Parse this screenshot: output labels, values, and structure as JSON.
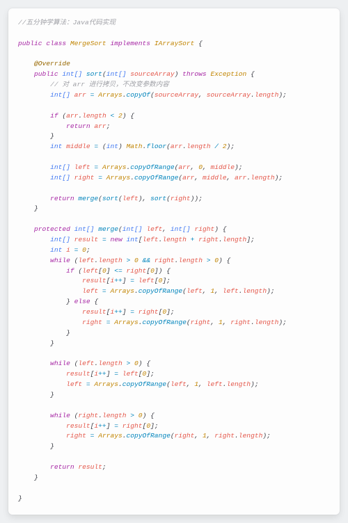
{
  "comment_top": "//五分钟学算法：Java代码实现",
  "comment_inner": "// 对 arr 进行拷贝，不改变参数内容",
  "kw": {
    "public": "public",
    "class": "class",
    "implements": "implements",
    "protected": "protected",
    "throws": "throws",
    "return": "return",
    "if": "if",
    "else": "else",
    "while": "while",
    "new": "new"
  },
  "type_int": "int",
  "type_intarr": "int[]",
  "cls": {
    "MergeSort": "MergeSort",
    "IArraySort": "IArraySort",
    "Arrays": "Arrays",
    "Math": "Math",
    "Exception": "Exception"
  },
  "ann_override": "@Override",
  "fn": {
    "sort": "sort",
    "merge": "merge",
    "copyOf": "copyOf",
    "floor": "floor",
    "copyOfRange": "copyOfRange"
  },
  "var": {
    "sourceArray": "sourceArray",
    "arr": "arr",
    "middle": "middle",
    "left": "left",
    "right": "right",
    "result": "result",
    "i": "i",
    "length": "length"
  },
  "num": {
    "n0": "0",
    "n1": "1",
    "n2": "2"
  },
  "op": {
    "lt": "<",
    "gt": ">",
    "eq": "=",
    "leq": "<=",
    "div": "/",
    "and": "&&",
    "pp": "++",
    "plus": "+"
  },
  "pn": {
    "ob": "{",
    "cb": "}",
    "op": "(",
    "cp": ")",
    "os": "[",
    "cs": "]",
    "sc": ";",
    "cm": ",",
    "dot": ".",
    "sp": " "
  }
}
